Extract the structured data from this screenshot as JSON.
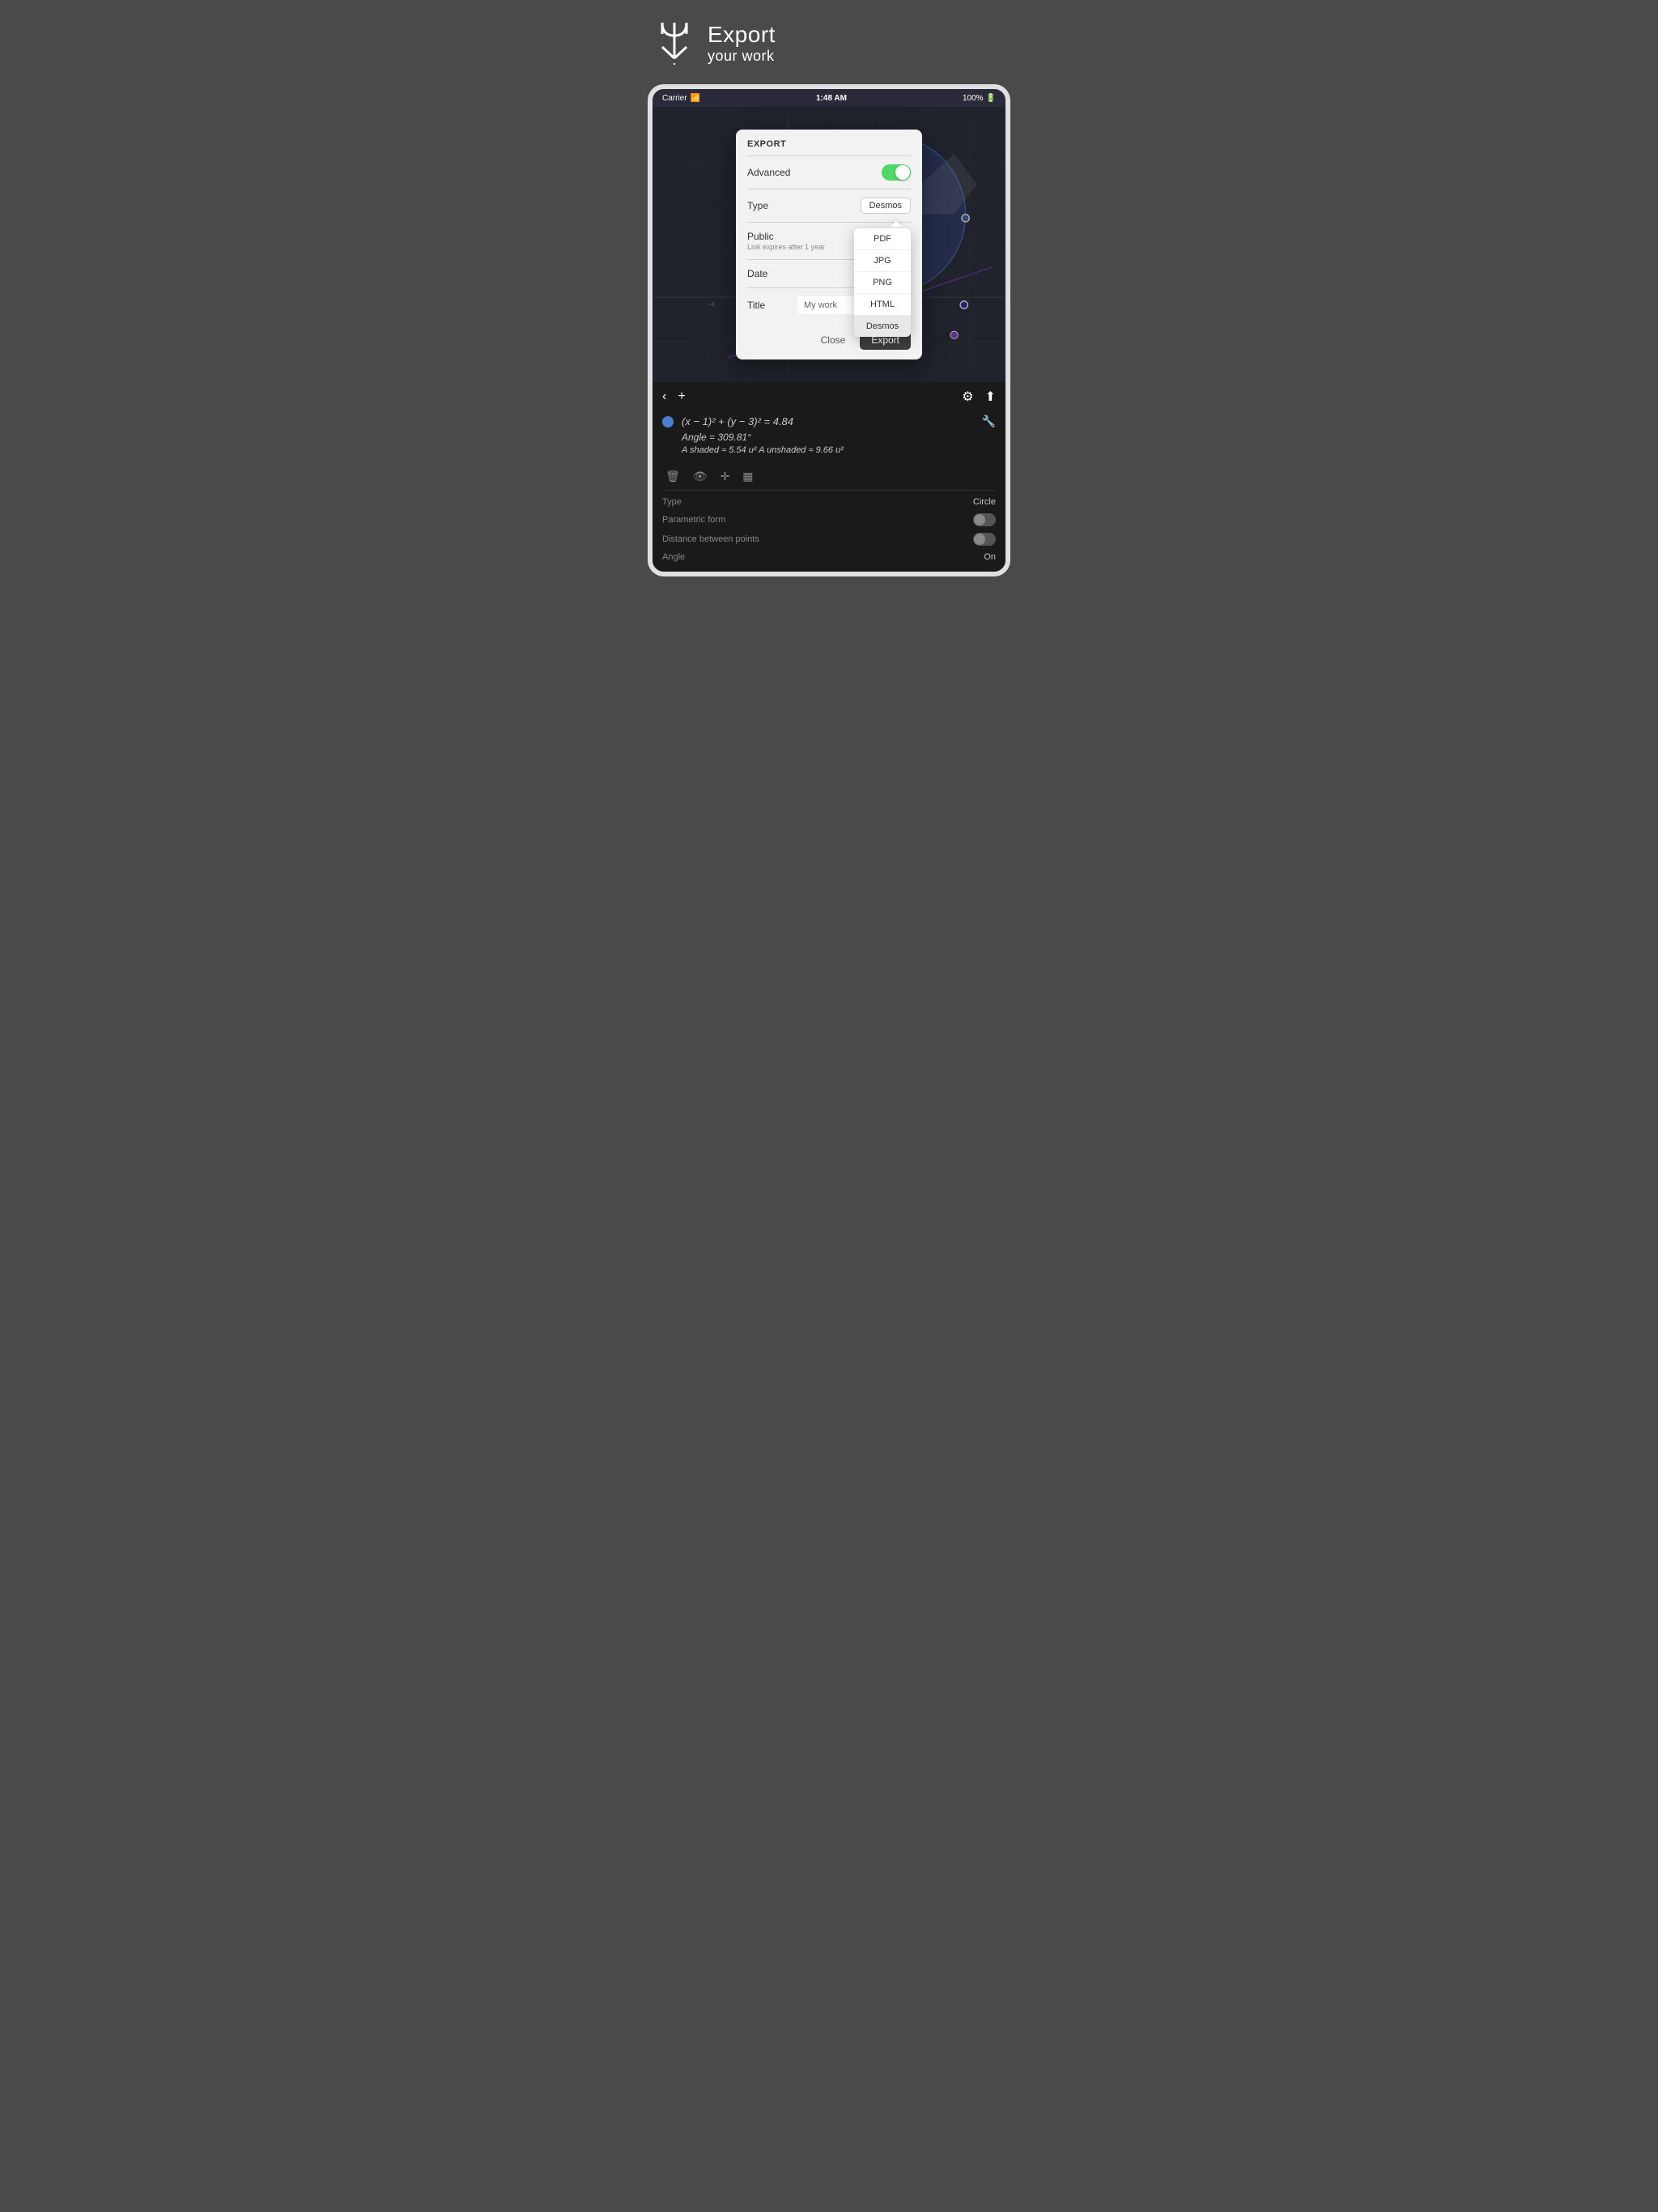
{
  "header": {
    "title_line1": "Export",
    "title_line2": "your work",
    "logo_symbol": "⌿"
  },
  "status_bar": {
    "carrier": "Carrier",
    "wifi_icon": "≋",
    "time": "1:48 AM",
    "battery": "100%"
  },
  "export_modal": {
    "title": "EXPORT",
    "advanced_label": "Advanced",
    "type_label": "Type",
    "type_value": "Desmos",
    "public_label": "Public",
    "public_sublabel": "Link expires after 1 year",
    "date_label": "Date",
    "title_label": "Title",
    "title_input_value": "My work",
    "close_button": "Close",
    "export_button": "Export",
    "dropdown": {
      "items": [
        "PDF",
        "JPG",
        "PNG",
        "HTML",
        "Desmos"
      ],
      "selected": "Desmos"
    }
  },
  "bottom_panel": {
    "equation1": "(x − 1)² + (y − 3)² = 4.84",
    "angle_label": "Angle = 309.81°",
    "area_label": "A shaded ≈ 5.54 u²  A unshaded ≈ 9.66 u²",
    "properties": [
      {
        "label": "Type",
        "value": "Circle"
      },
      {
        "label": "Parametric form",
        "value": "toggle"
      },
      {
        "label": "Distance between points",
        "value": "toggle"
      },
      {
        "label": "Angle",
        "value": "On"
      }
    ]
  },
  "toolbar": {
    "back_icon": "‹",
    "add_icon": "+",
    "settings_icon": "⚙",
    "share_icon": "↑",
    "wrench_icon": "🔧"
  }
}
